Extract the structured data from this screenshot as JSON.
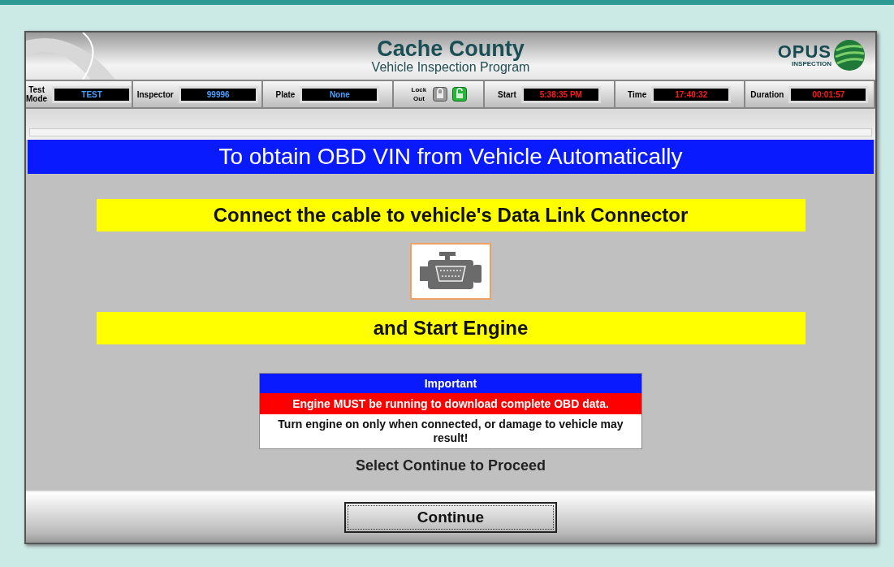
{
  "header": {
    "title": "Cache County",
    "subtitle": "Vehicle Inspection Program",
    "logo_main": "OPUS",
    "logo_sub": "INSPECTION"
  },
  "status_fields": [
    {
      "kind": "info",
      "label": "Test Mode",
      "value": "TEST"
    },
    {
      "kind": "info",
      "label": "Inspector",
      "value": "99996"
    },
    {
      "kind": "info",
      "label": "Plate",
      "value": "None"
    },
    {
      "kind": "lock",
      "label": "Lock Out",
      "locked": false
    },
    {
      "kind": "clock",
      "label": "Start",
      "value": "5:38:35 PM"
    },
    {
      "kind": "clock",
      "label": "Time",
      "value": "17:40:32"
    },
    {
      "kind": "clock",
      "label": "Duration",
      "value": "00:01:57"
    }
  ],
  "banner": "To obtain OBD VIN from Vehicle Automatically",
  "instruction_1": "Connect the cable to vehicle's Data Link Connector",
  "instruction_2": "and Start Engine",
  "notice": {
    "heading": "Important",
    "warning": "Engine MUST be running to download complete OBD data.",
    "message": "Turn engine on only when connected, or damage to vehicle may result!"
  },
  "prompt": "Select Continue to Proceed",
  "button": "Continue"
}
